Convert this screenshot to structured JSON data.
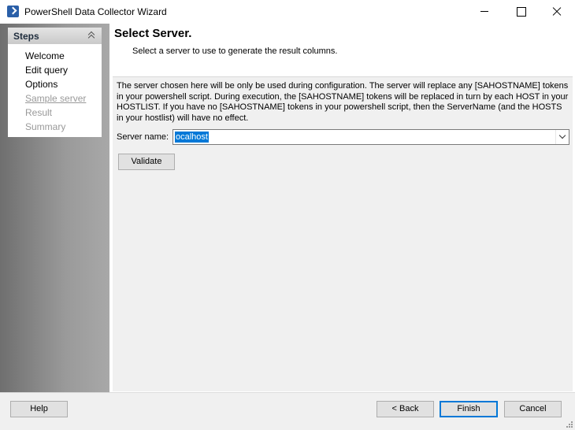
{
  "window": {
    "title": "PowerShell Data Collector Wizard",
    "icon": "powershell-icon"
  },
  "steps": {
    "header": "Steps",
    "items": [
      {
        "label": "Welcome",
        "state": "done"
      },
      {
        "label": "Edit query",
        "state": "done"
      },
      {
        "label": "Options",
        "state": "done"
      },
      {
        "label": "Sample server",
        "state": "current"
      },
      {
        "label": "Result",
        "state": "pending"
      },
      {
        "label": "Summary",
        "state": "pending"
      }
    ]
  },
  "page": {
    "title": "Select Server.",
    "subtitle": "Select a server to use to generate the result columns.",
    "description": "The server chosen here will be only be used during configuration. The server will replace any [SAHOSTNAME] tokens in your powershell script. During execution, the [SAHOSTNAME] tokens will be replaced in turn by each HOST in your HOSTLIST. If you have no [SAHOSTNAME] tokens in your powershell script, then the ServerName (and the HOSTS in your hostlist) will have no effect.",
    "server_label": "Server name:",
    "server_value": "ocalhost",
    "validate_label": "Validate"
  },
  "footer": {
    "help_label": "Help",
    "back_label": "< Back",
    "finish_label": "Finish",
    "cancel_label": "Cancel"
  },
  "colors": {
    "selection": "#0078d7",
    "default_button_border": "#0078d7"
  }
}
